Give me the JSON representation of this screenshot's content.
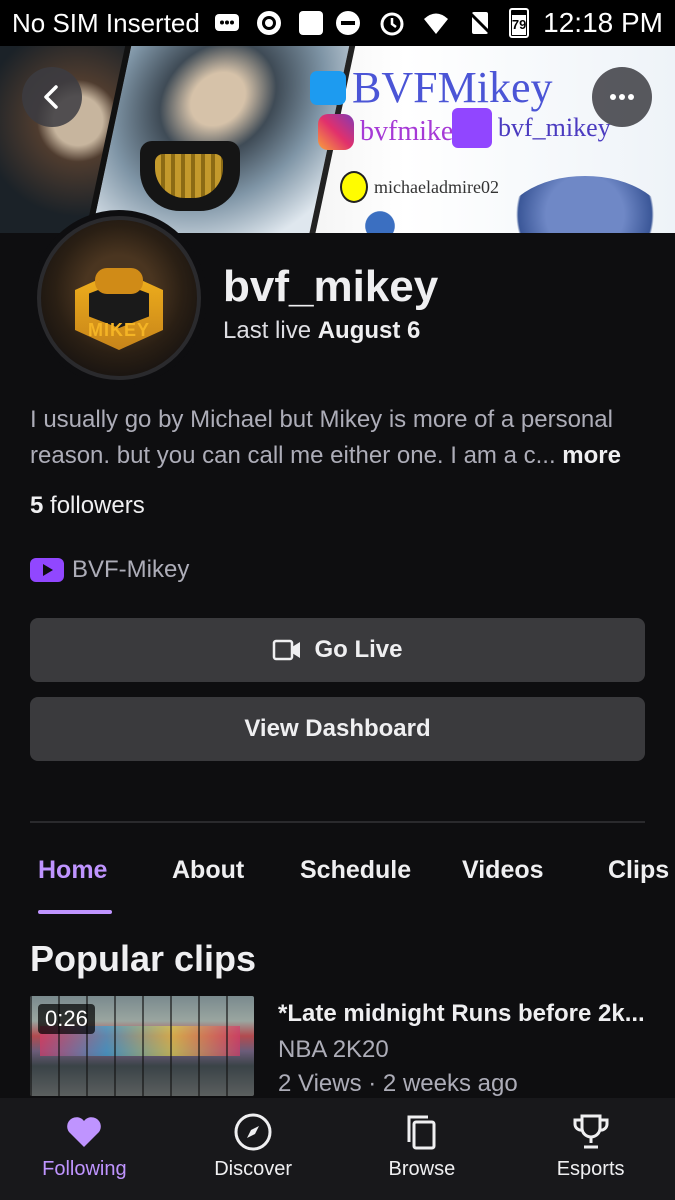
{
  "status_bar": {
    "carrier": "No SIM Inserted",
    "battery": "79",
    "time": "12:18 PM"
  },
  "banner": {
    "twitter": "BVFMikey",
    "instagram": "bvfmikey",
    "twitch": "bvf_mikey",
    "snapchat": "michaeladmire02"
  },
  "avatar": {
    "text": "MIKEY"
  },
  "profile": {
    "username": "bvf_mikey",
    "last_live_label": "Last live",
    "last_live_date": "August 6",
    "bio": "I usually go by Michael but Mikey is more of a personal reason. but you can call me either one. I am a c...",
    "bio_more": "more",
    "followers_count": "5",
    "followers_label": "followers",
    "social_link": "BVF-Mikey"
  },
  "actions": {
    "go_live": "Go Live",
    "view_dashboard": "View Dashboard"
  },
  "tabs": [
    "Home",
    "About",
    "Schedule",
    "Videos",
    "Clips"
  ],
  "popular_clips": {
    "title": "Popular clips",
    "items": [
      {
        "duration": "0:26",
        "title": "*Late midnight Runs before 2k...",
        "game": "NBA 2K20",
        "meta": "2 Views · 2 weeks ago"
      }
    ]
  },
  "bottom_nav": [
    "Following",
    "Discover",
    "Browse",
    "Esports"
  ],
  "colors": {
    "accent": "#bf94ff",
    "background": "#0e0e10",
    "button": "#3a3a3d"
  }
}
